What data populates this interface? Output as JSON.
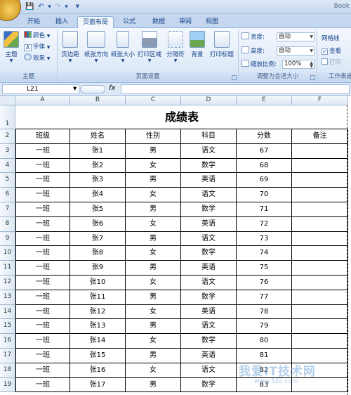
{
  "app": {
    "window_title": "Book"
  },
  "tabs": [
    "开始",
    "插入",
    "页面布局",
    "公式",
    "数据",
    "审阅",
    "视图"
  ],
  "active_tab": "页面布局",
  "ribbon": {
    "theme_group": {
      "label": "主题",
      "big_button": "主题",
      "items": [
        "颜色",
        "字体",
        "效果"
      ]
    },
    "page_setup_group": {
      "label": "页面设置",
      "buttons": [
        "页边距",
        "纸张方向",
        "纸张大小",
        "打印区域",
        "分隔符",
        "背景",
        "打印标题"
      ]
    },
    "scale_group": {
      "label": "调整为合适大小",
      "width_label": "宽度:",
      "width_value": "自动",
      "height_label": "高度:",
      "height_value": "自动",
      "scale_label": "缩放比例:",
      "scale_value": "100%"
    },
    "sheet_options_group": {
      "label": "工作表选",
      "gridlines_label": "网格线",
      "view_label": "查看",
      "print_label": "打印"
    }
  },
  "formula_bar": {
    "name_box": "L21",
    "fx": "fx",
    "formula": ""
  },
  "columns": [
    "A",
    "B",
    "C",
    "D",
    "E",
    "F"
  ],
  "rows": [
    "1",
    "2",
    "3",
    "4",
    "5",
    "6",
    "7",
    "8",
    "9",
    "10",
    "11",
    "12",
    "13",
    "14",
    "15",
    "16",
    "17",
    "18",
    "19"
  ],
  "sheet": {
    "title": "成绩表",
    "headers": [
      "班级",
      "姓名",
      "性别",
      "科目",
      "分数",
      "备注"
    ],
    "records": [
      [
        "一班",
        "张1",
        "男",
        "语文",
        "67",
        ""
      ],
      [
        "一班",
        "张2",
        "女",
        "数学",
        "68",
        ""
      ],
      [
        "一班",
        "张3",
        "男",
        "英语",
        "69",
        ""
      ],
      [
        "一班",
        "张4",
        "女",
        "语文",
        "70",
        ""
      ],
      [
        "一班",
        "张5",
        "男",
        "数学",
        "71",
        ""
      ],
      [
        "一班",
        "张6",
        "女",
        "英语",
        "72",
        ""
      ],
      [
        "一班",
        "张7",
        "男",
        "语文",
        "73",
        ""
      ],
      [
        "一班",
        "张8",
        "女",
        "数学",
        "74",
        ""
      ],
      [
        "一班",
        "张9",
        "男",
        "英语",
        "75",
        ""
      ],
      [
        "一班",
        "张10",
        "女",
        "语文",
        "76",
        ""
      ],
      [
        "一班",
        "张11",
        "男",
        "数学",
        "77",
        ""
      ],
      [
        "一班",
        "张12",
        "女",
        "英语",
        "78",
        ""
      ],
      [
        "一班",
        "张13",
        "男",
        "语文",
        "79",
        ""
      ],
      [
        "一班",
        "张14",
        "女",
        "数学",
        "80",
        ""
      ],
      [
        "一班",
        "张15",
        "男",
        "英语",
        "81",
        ""
      ],
      [
        "一班",
        "张16",
        "女",
        "语文",
        "82",
        ""
      ],
      [
        "一班",
        "张17",
        "男",
        "数学",
        "83",
        ""
      ]
    ]
  },
  "watermark": {
    "text": "我爱IT技术网",
    "url": "www.52ij.com"
  }
}
